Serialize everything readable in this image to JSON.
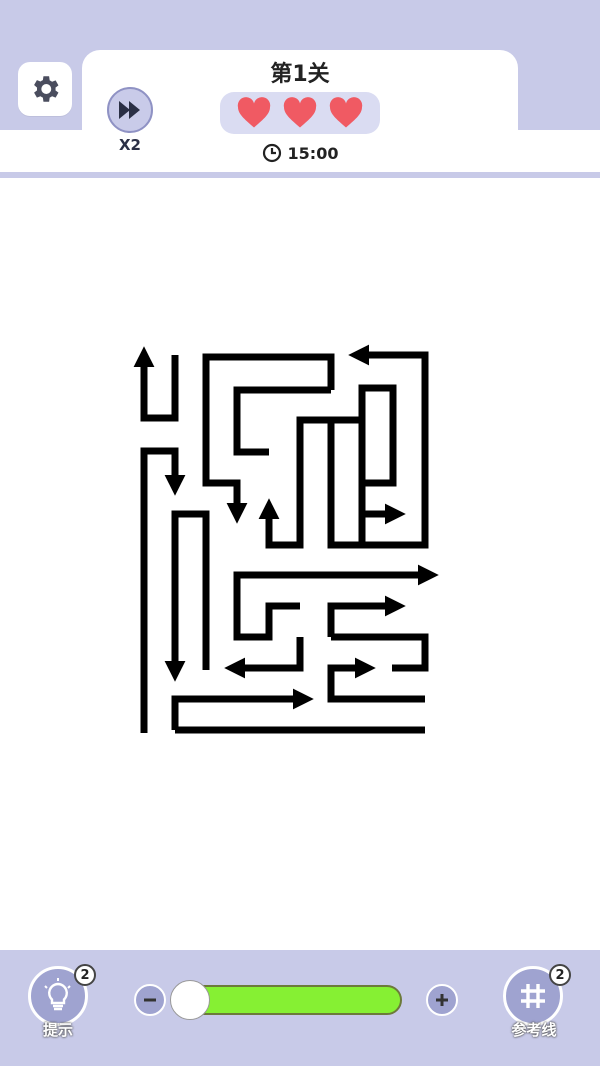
{
  "header": {
    "level_title": "第1关",
    "speed_label": "X2",
    "timer": "15:00",
    "lives": 3,
    "heart_color": "#f05a63"
  },
  "bottom": {
    "hint_label": "提示",
    "hint_count": "2",
    "guide_label": "参考线",
    "guide_count": "2",
    "zoom_level": 0.0
  },
  "colors": {
    "panel": "#c8cae8",
    "accent": "#9fa3d0",
    "slider": "#86f033"
  },
  "icons": [
    "gear-icon",
    "fast-forward-icon",
    "heart-icon",
    "clock-icon",
    "lightbulb-icon",
    "hash-icon",
    "minus-icon",
    "plus-icon"
  ]
}
